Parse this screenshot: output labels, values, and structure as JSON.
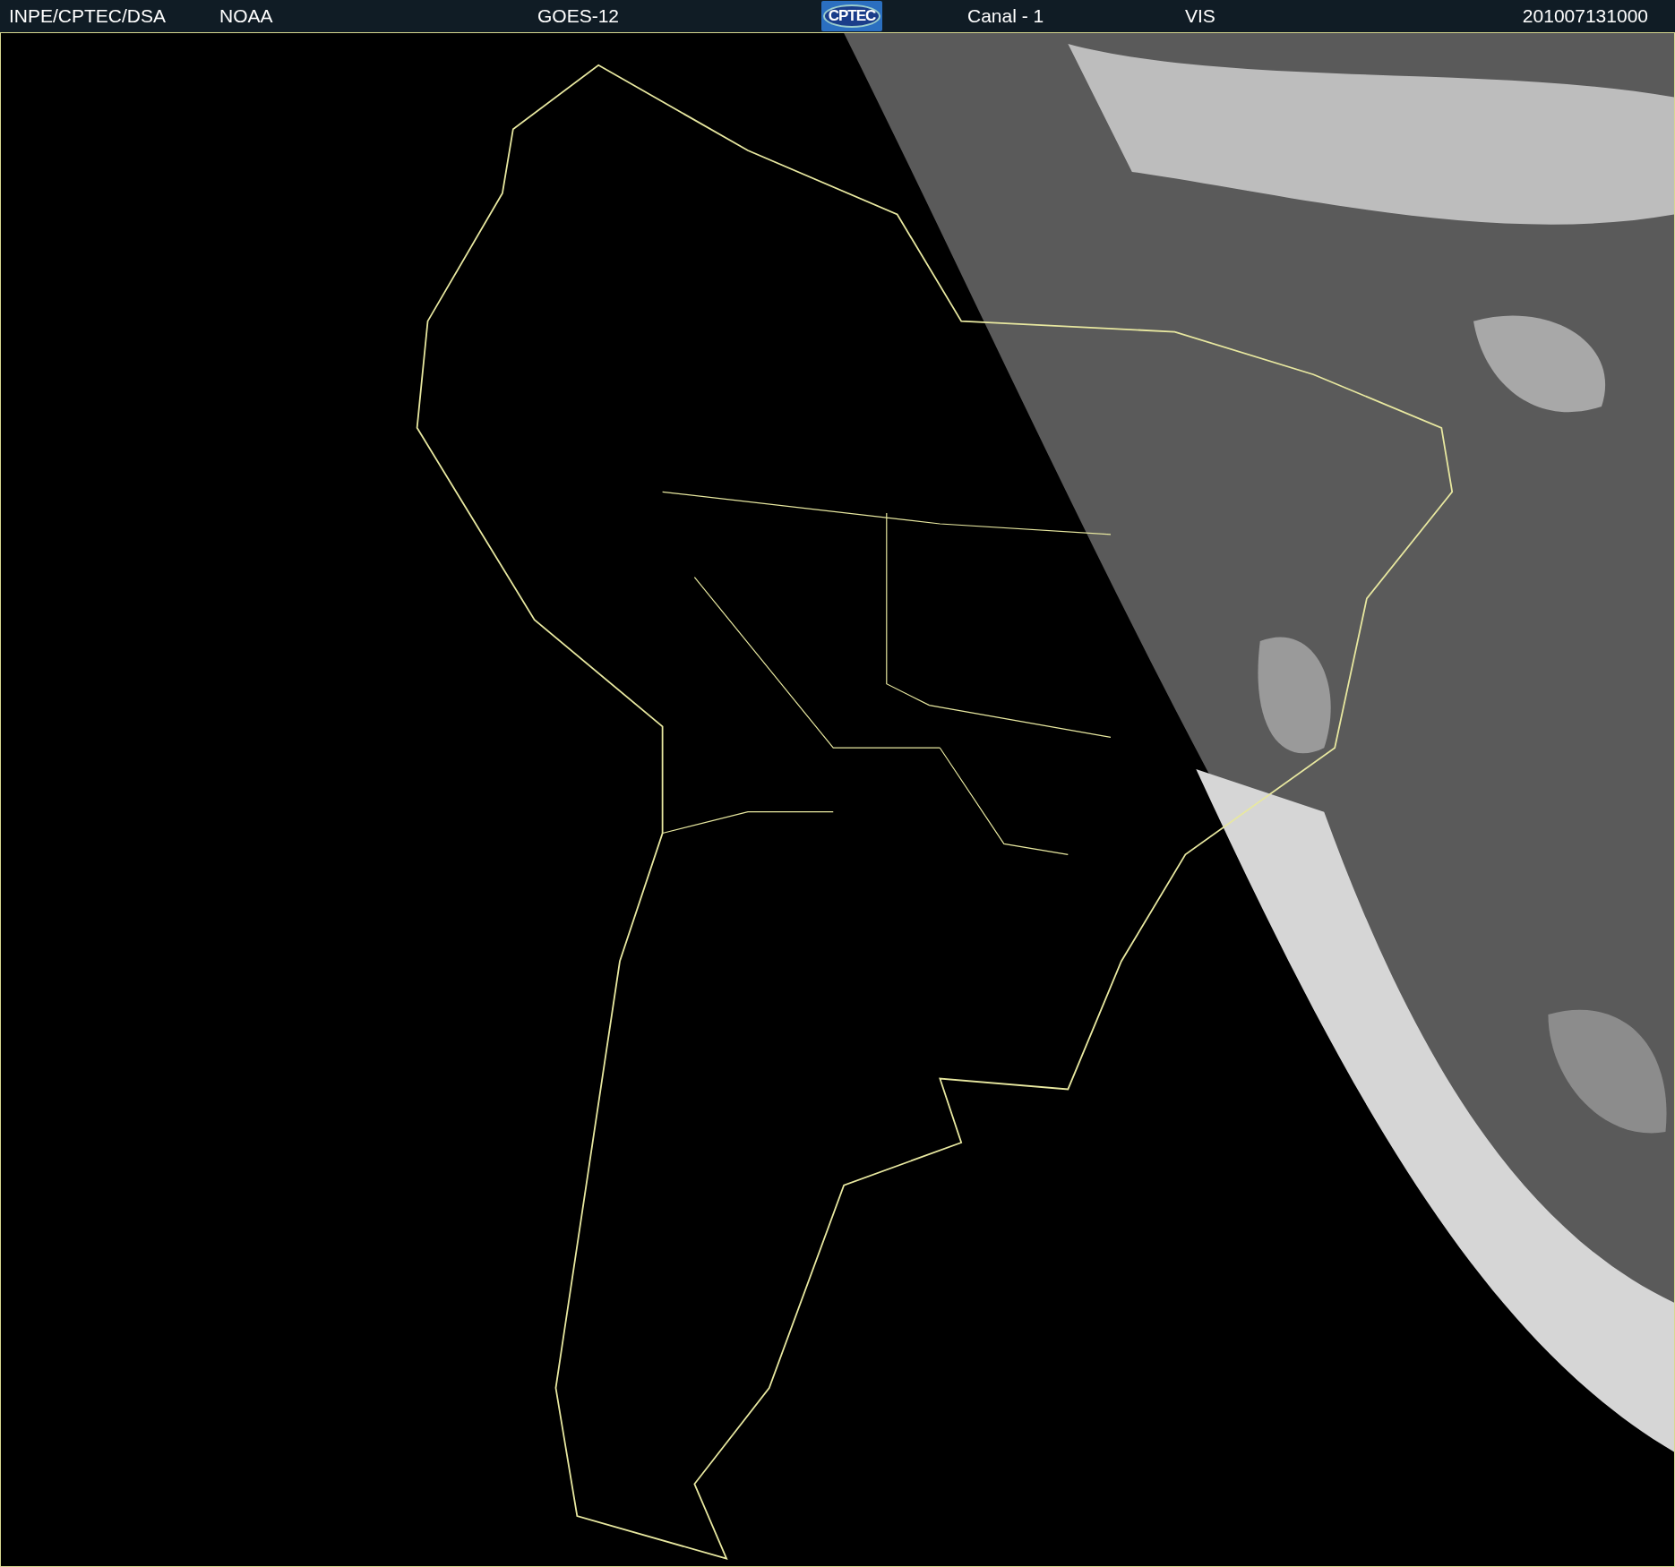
{
  "header": {
    "source": "INPE/CPTEC/DSA",
    "agency": "NOAA",
    "satellite": "GOES-12",
    "logo": "CPTEC",
    "channel": "Canal - 1",
    "band": "VIS",
    "timestamp": "201007131000"
  }
}
